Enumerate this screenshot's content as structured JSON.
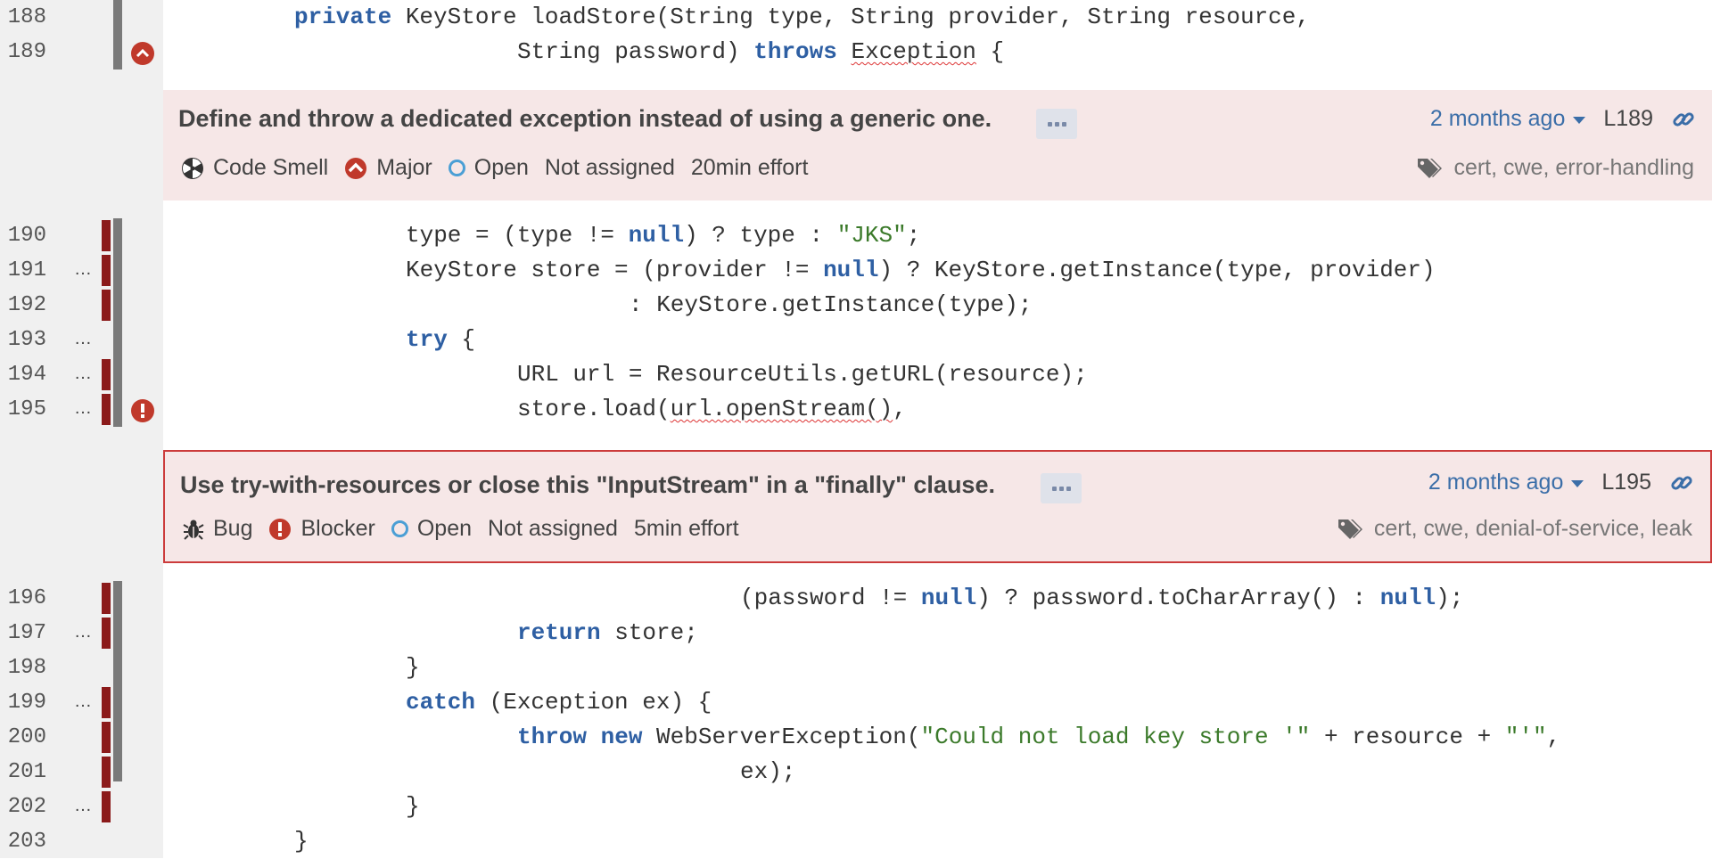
{
  "lines": [
    {
      "num": "188"
    },
    {
      "num": "189"
    },
    {
      "num": "190"
    },
    {
      "num": "191",
      "dots": "…"
    },
    {
      "num": "192"
    },
    {
      "num": "193",
      "dots": "…"
    },
    {
      "num": "194",
      "dots": "…"
    },
    {
      "num": "195",
      "dots": "…"
    },
    {
      "num": "196"
    },
    {
      "num": "197",
      "dots": "…"
    },
    {
      "num": "198"
    },
    {
      "num": "199",
      "dots": "…"
    },
    {
      "num": "200"
    },
    {
      "num": "201"
    },
    {
      "num": "202",
      "dots": "…"
    },
    {
      "num": "203"
    }
  ],
  "code": {
    "l188": {
      "kw1": "private",
      "t1": " KeyStore loadStore(String type, String provider, String resource,"
    },
    "l189": {
      "t1": "String password) ",
      "kw1": "throws",
      "t2": " ",
      "err": "Exception",
      "t3": " {"
    },
    "l190": {
      "t1": "type = (type != ",
      "kw1": "null",
      "t2": ") ? type : ",
      "s1": "\"JKS\"",
      "t3": ";"
    },
    "l191": {
      "t1": "KeyStore store = (provider != ",
      "kw1": "null",
      "t2": ") ? KeyStore.getInstance(type, provider)"
    },
    "l192": {
      "t1": ": KeyStore.getInstance(type);"
    },
    "l193": {
      "kw1": "try",
      "t1": " {"
    },
    "l194": {
      "t1": "URL url = ResourceUtils.getURL(resource);"
    },
    "l195": {
      "t1": "store.load(",
      "err": "url.openStream()",
      "t2": ","
    },
    "l196": {
      "t1": "(password != ",
      "kw1": "null",
      "t2": ") ? password.toCharArray() : ",
      "kw2": "null",
      "t3": ");"
    },
    "l197": {
      "kw1": "return",
      "t1": " store;"
    },
    "l198": {
      "t1": "}"
    },
    "l199": {
      "kw1": "catch",
      "t1": " (Exception ex) {"
    },
    "l200": {
      "kw1": "throw",
      "t1": " ",
      "kw2": "new",
      "t2": " WebServerException(",
      "s1": "\"Could not load key store '\"",
      "t3": " + resource + ",
      "s2": "\"'\"",
      "t4": ","
    },
    "l201": {
      "t1": "ex);"
    },
    "l202": {
      "t1": "}"
    },
    "l203": {
      "t1": "}"
    }
  },
  "issues": [
    {
      "message": "Define and throw a dedicated exception instead of using a generic one.",
      "type": "Code Smell",
      "severity": "Major",
      "status": "Open",
      "assignee": "Not assigned",
      "effort": "20min effort",
      "date": "2 months ago",
      "line": "L189",
      "tags": "cert, cwe, error-handling"
    },
    {
      "message": "Use try-with-resources or close this \"InputStream\" in a \"finally\" clause.",
      "type": "Bug",
      "severity": "Blocker",
      "status": "Open",
      "assignee": "Not assigned",
      "effort": "5min effort",
      "date": "2 months ago",
      "line": "L195",
      "tags": "cert, cwe, denial-of-service, leak"
    }
  ],
  "colors": {
    "keyword": "#2e5fa3",
    "string": "#3b7a2a",
    "uncovered": "#8b1a1a",
    "duplicated": "#7a7a7a",
    "issue_bg": "#f6e7e7",
    "issue_border_selected": "#cc3b3b",
    "link": "#3b6ea8"
  }
}
